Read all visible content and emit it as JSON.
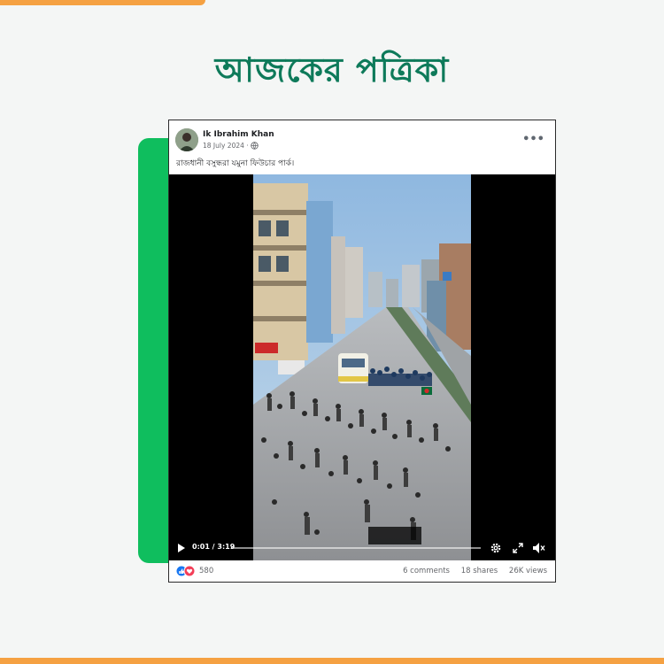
{
  "brand": {
    "logo_text": "আজকের পত্রিকা",
    "primary_color": "#0e7a5a",
    "accent_color": "#f5a142",
    "panel_color": "#0fbe5e"
  },
  "post": {
    "author_name": "Ik Ibrahim Khan",
    "date": "18 July 2024 ·",
    "audience_icon": "globe-icon",
    "more_icon": "more-options-icon",
    "text": "রাজধানী বসুন্ধরা যমুনা ফিউচার পার্ক।",
    "video": {
      "time": "0:01 / 3:19",
      "progress": 0.005
    },
    "footer": {
      "reaction_icons": [
        "like-icon",
        "love-icon"
      ],
      "reaction_count": "580",
      "comments": "6 comments",
      "shares": "18 shares",
      "views": "26K views"
    }
  }
}
